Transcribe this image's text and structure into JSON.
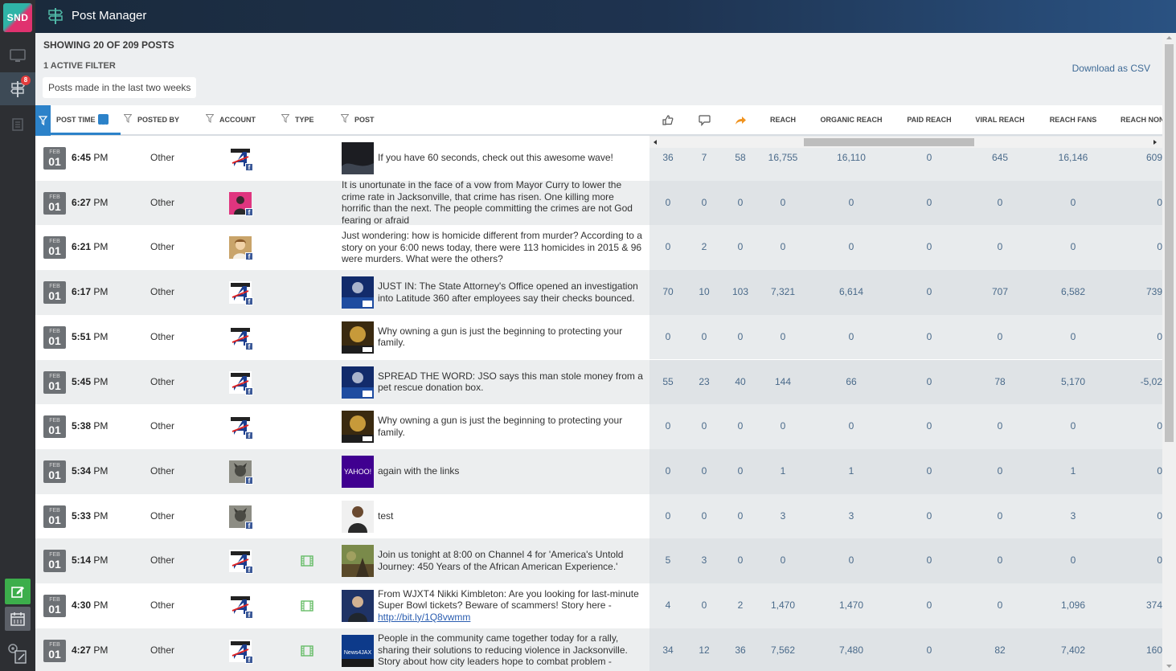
{
  "app": {
    "logo": "SND",
    "title": "Post Manager",
    "nav_badge": "8"
  },
  "summary": {
    "showing": "SHOWING 20 OF 209 POSTS",
    "active_filter": "1 ACTIVE FILTER",
    "filter_chip": "Posts made in the last two weeks",
    "download": "Download as CSV"
  },
  "columns": {
    "post_time": "POST TIME",
    "posted_by": "POSTED BY",
    "account": "ACCOUNT",
    "type": "TYPE",
    "post": "POST",
    "reach": "REACH",
    "organic_reach": "ORGANIC REACH",
    "paid_reach": "PAID REACH",
    "viral_reach": "VIRAL REACH",
    "reach_fans": "REACH FANS",
    "reach_nonfans": "REACH NON"
  },
  "icons": {
    "rail": [
      "monitor-icon",
      "signpost-icon",
      "document-icon",
      "compose-icon",
      "calendar-icon",
      "settings-icon"
    ],
    "metrics": [
      "like-icon",
      "comment-icon",
      "share-icon"
    ],
    "colors": {
      "accent": "#2c82c9",
      "compose": "#3cae4b",
      "badge": "#e43c3c",
      "facebook": "#3b5998"
    }
  },
  "rows": [
    {
      "month": "FEB",
      "day": "01",
      "time": "6:45",
      "ampm": "PM",
      "posted_by": "Other",
      "account": "wjxt4",
      "type": "",
      "thumb": "wave",
      "post": "If you have 60 seconds, check out this awesome wave!",
      "link": "",
      "likes": "36",
      "comments": "7",
      "shares": "58",
      "reach": "16,755",
      "organic": "16,110",
      "paid": "0",
      "viral": "645",
      "fans": "16,146",
      "nonfans": "609"
    },
    {
      "month": "FEB",
      "day": "01",
      "time": "6:27",
      "ampm": "PM",
      "posted_by": "Other",
      "account": "person-pink",
      "type": "",
      "thumb": "",
      "post": "It is unortunate in the face of a vow from Mayor Curry to lower the crime rate in Jacksonville, that crime has risen. One killing more horrific than the next. The people committing the crimes are not God fearing or afraid",
      "link": "",
      "likes": "0",
      "comments": "0",
      "shares": "0",
      "reach": "0",
      "organic": "0",
      "paid": "0",
      "viral": "0",
      "fans": "0",
      "nonfans": "0"
    },
    {
      "month": "FEB",
      "day": "01",
      "time": "6:21",
      "ampm": "PM",
      "posted_by": "Other",
      "account": "person-tan",
      "type": "",
      "thumb": "",
      "post": "Just wondering: how is homicide different from murder? According to a story on your 6:00 news today, there were 113 homicides in 2015 & 96 were murders. What were the others?",
      "link": "",
      "likes": "0",
      "comments": "2",
      "shares": "0",
      "reach": "0",
      "organic": "0",
      "paid": "0",
      "viral": "0",
      "fans": "0",
      "nonfans": "0"
    },
    {
      "month": "FEB",
      "day": "01",
      "time": "6:17",
      "ampm": "PM",
      "posted_by": "Other",
      "account": "wjxt4",
      "type": "",
      "thumb": "news-blue",
      "post": "JUST IN: The State Attorney's Office opened an investigation into Latitude 360 after employees say their checks bounced.",
      "link": "",
      "likes": "70",
      "comments": "10",
      "shares": "103",
      "reach": "7,321",
      "organic": "6,614",
      "paid": "0",
      "viral": "707",
      "fans": "6,582",
      "nonfans": "739"
    },
    {
      "month": "FEB",
      "day": "01",
      "time": "5:51",
      "ampm": "PM",
      "posted_by": "Other",
      "account": "wjxt4",
      "type": "",
      "thumb": "news-gold",
      "post": "Why owning a gun is just the beginning to protecting your family.",
      "link": "",
      "likes": "0",
      "comments": "0",
      "shares": "0",
      "reach": "0",
      "organic": "0",
      "paid": "0",
      "viral": "0",
      "fans": "0",
      "nonfans": "0"
    },
    {
      "month": "FEB",
      "day": "01",
      "time": "5:45",
      "ampm": "PM",
      "posted_by": "Other",
      "account": "wjxt4",
      "type": "",
      "thumb": "news-blue",
      "post": "SPREAD THE WORD: JSO says this man stole money from a pet rescue donation box.",
      "link": "",
      "likes": "55",
      "comments": "23",
      "shares": "40",
      "reach": "144",
      "organic": "66",
      "paid": "0",
      "viral": "78",
      "fans": "5,170",
      "nonfans": "-5,02"
    },
    {
      "month": "FEB",
      "day": "01",
      "time": "5:38",
      "ampm": "PM",
      "posted_by": "Other",
      "account": "wjxt4",
      "type": "",
      "thumb": "news-gold",
      "post": "Why owning a gun is just the beginning to protecting your family.",
      "link": "",
      "likes": "0",
      "comments": "0",
      "shares": "0",
      "reach": "0",
      "organic": "0",
      "paid": "0",
      "viral": "0",
      "fans": "0",
      "nonfans": "0"
    },
    {
      "month": "FEB",
      "day": "01",
      "time": "5:34",
      "ampm": "PM",
      "posted_by": "Other",
      "account": "person-dog",
      "type": "",
      "thumb": "yahoo",
      "thumb_text": "YAHOO!",
      "post": "again with the links",
      "link": "",
      "likes": "0",
      "comments": "0",
      "shares": "0",
      "reach": "1",
      "organic": "1",
      "paid": "0",
      "viral": "0",
      "fans": "1",
      "nonfans": "0"
    },
    {
      "month": "FEB",
      "day": "01",
      "time": "5:33",
      "ampm": "PM",
      "posted_by": "Other",
      "account": "person-dog",
      "type": "",
      "thumb": "portrait",
      "post": "test",
      "link": "",
      "likes": "0",
      "comments": "0",
      "shares": "0",
      "reach": "3",
      "organic": "3",
      "paid": "0",
      "viral": "0",
      "fans": "3",
      "nonfans": "0"
    },
    {
      "month": "FEB",
      "day": "01",
      "time": "5:14",
      "ampm": "PM",
      "posted_by": "Other",
      "account": "wjxt4",
      "type": "video",
      "thumb": "landscape",
      "post": "Join us tonight at 8:00 on Channel 4 for 'America's Untold Journey: 450 Years of the African American Experience.'",
      "link": "",
      "likes": "5",
      "comments": "3",
      "shares": "0",
      "reach": "0",
      "organic": "0",
      "paid": "0",
      "viral": "0",
      "fans": "0",
      "nonfans": "0"
    },
    {
      "month": "FEB",
      "day": "01",
      "time": "4:30",
      "ampm": "PM",
      "posted_by": "Other",
      "account": "wjxt4",
      "type": "video",
      "thumb": "anchor",
      "post": "From WJXT4 Nikki Kimbleton: Are you looking for last-minute Super Bowl tickets? Beware of scammers! Story here -",
      "link": "http://bit.ly/1Q8vwmm",
      "likes": "4",
      "comments": "0",
      "shares": "2",
      "reach": "1,470",
      "organic": "1,470",
      "paid": "0",
      "viral": "0",
      "fans": "1,096",
      "nonfans": "374"
    },
    {
      "month": "FEB",
      "day": "01",
      "time": "4:27",
      "ampm": "PM",
      "posted_by": "Other",
      "account": "wjxt4",
      "type": "video",
      "thumb": "news4jax",
      "thumb_text": "News4JAX",
      "post": "People in the community came together today for a rally, sharing their solutions to reducing violence in Jacksonville. Story about how city leaders hope to combat problem -",
      "link": "",
      "likes": "34",
      "comments": "12",
      "shares": "36",
      "reach": "7,562",
      "organic": "7,480",
      "paid": "0",
      "viral": "82",
      "fans": "7,402",
      "nonfans": "160"
    }
  ]
}
